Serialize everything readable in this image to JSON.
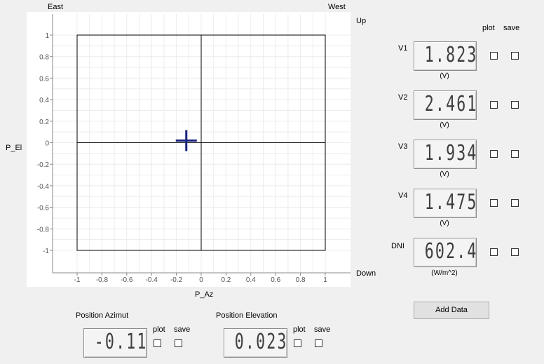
{
  "plot": {
    "label_east": "East",
    "label_west": "West",
    "label_up": "Up",
    "label_down": "Down",
    "ylabel": "P_El",
    "xlabel": "P_Az",
    "x_ticks": [
      "-1",
      "-0.8",
      "-0.6",
      "-0.4",
      "-0.2",
      "0",
      "0.2",
      "0.4",
      "0.6",
      "0.8",
      "1"
    ],
    "y_ticks": [
      "1",
      "0.8",
      "0.6",
      "0.4",
      "0.2",
      "0",
      "-0.2",
      "-0.4",
      "-0.6",
      "-0.8",
      "-1"
    ],
    "marker": {
      "x": -0.12,
      "y": 0.02
    },
    "marker_color": "#1a237e"
  },
  "header": {
    "plot_label": "plot",
    "save_label": "save"
  },
  "channels": [
    {
      "name": "V1",
      "value": "1.823",
      "unit": "(V)"
    },
    {
      "name": "V2",
      "value": "2.461",
      "unit": "(V)"
    },
    {
      "name": "V3",
      "value": "1.934",
      "unit": "(V)"
    },
    {
      "name": "V4",
      "value": "1.475",
      "unit": "(V)"
    },
    {
      "name": "DNI",
      "value": "602.4",
      "unit": "(W/m^2)"
    }
  ],
  "add_data_label": "Add Data",
  "position_azimut": {
    "title": "Position Azimut",
    "value": "-0.11",
    "plot_label": "plot",
    "save_label": "save"
  },
  "position_elevation": {
    "title": "Position Elevation",
    "value": "0.023",
    "plot_label": "plot",
    "save_label": "save"
  }
}
